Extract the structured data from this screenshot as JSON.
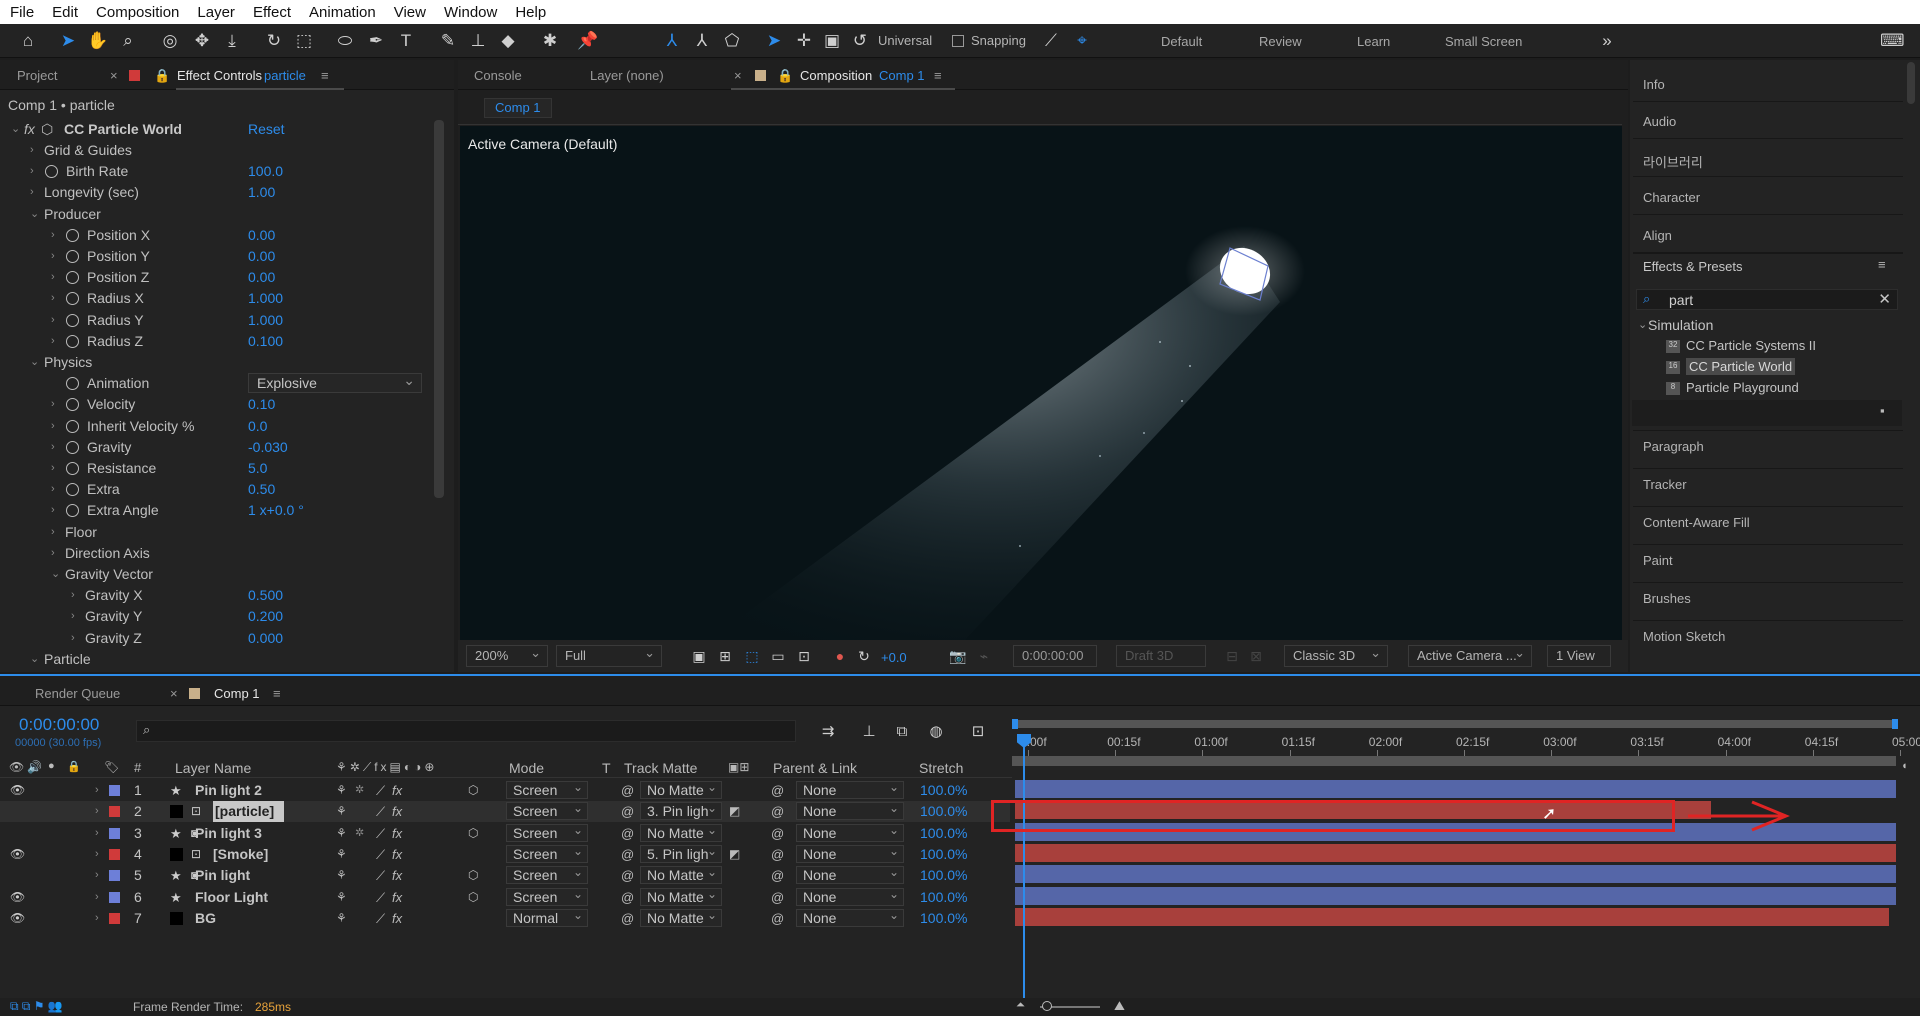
{
  "menu": [
    "File",
    "Edit",
    "Composition",
    "Layer",
    "Effect",
    "Animation",
    "View",
    "Window",
    "Help"
  ],
  "toolbar": {
    "universal": "Universal",
    "snapping": "Snapping"
  },
  "workspaces": [
    "Default",
    "Review",
    "Learn",
    "Small Screen"
  ],
  "left_panel": {
    "tab_project": "Project",
    "tab_effect_controls": "Effect Controls",
    "tab_effect_target": "particle",
    "breadcrumb": "Comp 1 • particle",
    "effect_name": "CC Particle World",
    "reset": "Reset",
    "rows": [
      {
        "label": "Grid & Guides",
        "value": "",
        "indent": 1,
        "stopwatch": false,
        "open": false
      },
      {
        "label": "Birth Rate",
        "value": "100.0",
        "indent": 1,
        "stopwatch": true,
        "open": false
      },
      {
        "label": "Longevity (sec)",
        "value": "1.00",
        "indent": 1,
        "stopwatch": false,
        "open": false
      },
      {
        "label": "Producer",
        "value": "",
        "indent": 1,
        "stopwatch": false,
        "open": true
      },
      {
        "label": "Position X",
        "value": "0.00",
        "indent": 2,
        "stopwatch": true,
        "open": false
      },
      {
        "label": "Position Y",
        "value": "0.00",
        "indent": 2,
        "stopwatch": true,
        "open": false
      },
      {
        "label": "Position Z",
        "value": "0.00",
        "indent": 2,
        "stopwatch": true,
        "open": false
      },
      {
        "label": "Radius X",
        "value": "1.000",
        "indent": 2,
        "stopwatch": true,
        "open": false
      },
      {
        "label": "Radius Y",
        "value": "1.000",
        "indent": 2,
        "stopwatch": true,
        "open": false
      },
      {
        "label": "Radius Z",
        "value": "0.100",
        "indent": 2,
        "stopwatch": true,
        "open": false
      },
      {
        "label": "Physics",
        "value": "",
        "indent": 1,
        "stopwatch": false,
        "open": true
      },
      {
        "label": "Animation",
        "value": "",
        "indent": 2,
        "stopwatch": true,
        "open": null
      },
      {
        "label": "Velocity",
        "value": "0.10",
        "indent": 2,
        "stopwatch": true,
        "open": false
      },
      {
        "label": "Inherit Velocity %",
        "value": "0.0",
        "indent": 2,
        "stopwatch": true,
        "open": false
      },
      {
        "label": "Gravity",
        "value": "-0.030",
        "indent": 2,
        "stopwatch": true,
        "open": false
      },
      {
        "label": "Resistance",
        "value": "5.0",
        "indent": 2,
        "stopwatch": true,
        "open": false
      },
      {
        "label": "Extra",
        "value": "0.50",
        "indent": 2,
        "stopwatch": true,
        "open": false
      },
      {
        "label": "Extra Angle",
        "value": "1 x+0.0 °",
        "indent": 2,
        "stopwatch": true,
        "open": false
      },
      {
        "label": "Floor",
        "value": "",
        "indent": 2,
        "stopwatch": false,
        "open": false
      },
      {
        "label": "Direction Axis",
        "value": "",
        "indent": 2,
        "stopwatch": false,
        "open": false
      },
      {
        "label": "Gravity Vector",
        "value": "",
        "indent": 2,
        "stopwatch": false,
        "open": true
      },
      {
        "label": "Gravity X",
        "value": "0.500",
        "indent": 3,
        "stopwatch": false,
        "open": false
      },
      {
        "label": "Gravity Y",
        "value": "0.200",
        "indent": 3,
        "stopwatch": false,
        "open": false
      },
      {
        "label": "Gravity Z",
        "value": "0.000",
        "indent": 3,
        "stopwatch": false,
        "open": false
      },
      {
        "label": "Particle",
        "value": "",
        "indent": 1,
        "stopwatch": false,
        "open": true
      }
    ],
    "animation_select": "Explosive"
  },
  "comp_panel": {
    "tab_console": "Console",
    "tab_layer": "Layer (none)",
    "tab_composition": "Composition",
    "tab_comp_name": "Comp 1",
    "subtab": "Comp 1",
    "camera_label": "Active Camera (Default)",
    "zoom": "200%",
    "resolution": "Full",
    "exposure": "+0.0",
    "timecode": "0:00:00:00",
    "draft3d": "Draft 3D",
    "renderer": "Classic 3D",
    "camera": "Active Camera ...",
    "views": "1 View"
  },
  "right_panel": {
    "items_top": [
      "Info",
      "Audio",
      "라이브러리",
      "Character",
      "Align"
    ],
    "effects_title": "Effects & Presets",
    "search_value": "part",
    "category": "Simulation",
    "effects": [
      "CC Particle Systems II",
      "CC Particle World",
      "Particle Playground"
    ],
    "items_bottom": [
      "Paragraph",
      "Tracker",
      "Content-Aware Fill",
      "Paint",
      "Brushes",
      "Motion Sketch"
    ]
  },
  "timeline": {
    "tab_render_queue": "Render Queue",
    "tab_comp": "Comp 1",
    "timecode": "0:00:00:00",
    "frames": "00000 (30.00 fps)",
    "headers": {
      "num": "#",
      "name": "Layer Name",
      "mode": "Mode",
      "t": "T",
      "matte": "Track Matte",
      "parent": "Parent & Link",
      "stretch": "Stretch"
    },
    "ruler": [
      "0:00f",
      "00:15f",
      "01:00f",
      "01:15f",
      "02:00f",
      "02:15f",
      "03:00f",
      "03:15f",
      "04:00f",
      "04:15f",
      "05:00"
    ],
    "layers": [
      {
        "num": "1",
        "name": "Pin light 2",
        "color": "#6d7fd8",
        "mode": "Screen",
        "matte": "No Matte",
        "parent": "None",
        "stretch": "100.0%",
        "bar": "#5566a8",
        "visible": true
      },
      {
        "num": "2",
        "name": "[particle]",
        "color": "#d03a3a",
        "mode": "Screen",
        "matte": "3. Pin ligh",
        "parent": "None",
        "stretch": "100.0%",
        "bar": "#a8403c",
        "visible": false
      },
      {
        "num": "3",
        "name": "Pin light 3",
        "color": "#6d7fd8",
        "mode": "Screen",
        "matte": "No Matte",
        "parent": "None",
        "stretch": "100.0%",
        "bar": "#5566a8",
        "visible": false
      },
      {
        "num": "4",
        "name": "[Smoke]",
        "color": "#d03a3a",
        "mode": "Screen",
        "matte": "5. Pin ligh",
        "parent": "None",
        "stretch": "100.0%",
        "bar": "#a8403c",
        "visible": true
      },
      {
        "num": "5",
        "name": "Pin light",
        "color": "#6d7fd8",
        "mode": "Screen",
        "matte": "No Matte",
        "parent": "None",
        "stretch": "100.0%",
        "bar": "#5566a8",
        "visible": false
      },
      {
        "num": "6",
        "name": "Floor Light",
        "color": "#6d7fd8",
        "mode": "Screen",
        "matte": "No Matte",
        "parent": "None",
        "stretch": "100.0%",
        "bar": "#5566a8",
        "visible": true
      },
      {
        "num": "7",
        "name": "BG",
        "color": "#d03a3a",
        "mode": "Normal",
        "matte": "No Matte",
        "parent": "None",
        "stretch": "100.0%",
        "bar": "#a8403c",
        "visible": true
      }
    ],
    "render_label": "Frame Render Time:",
    "render_value": "285ms"
  },
  "colors": {
    "accent": "#2d8ceb",
    "annotation": "#e02424",
    "render_time": "#e8a33a"
  }
}
